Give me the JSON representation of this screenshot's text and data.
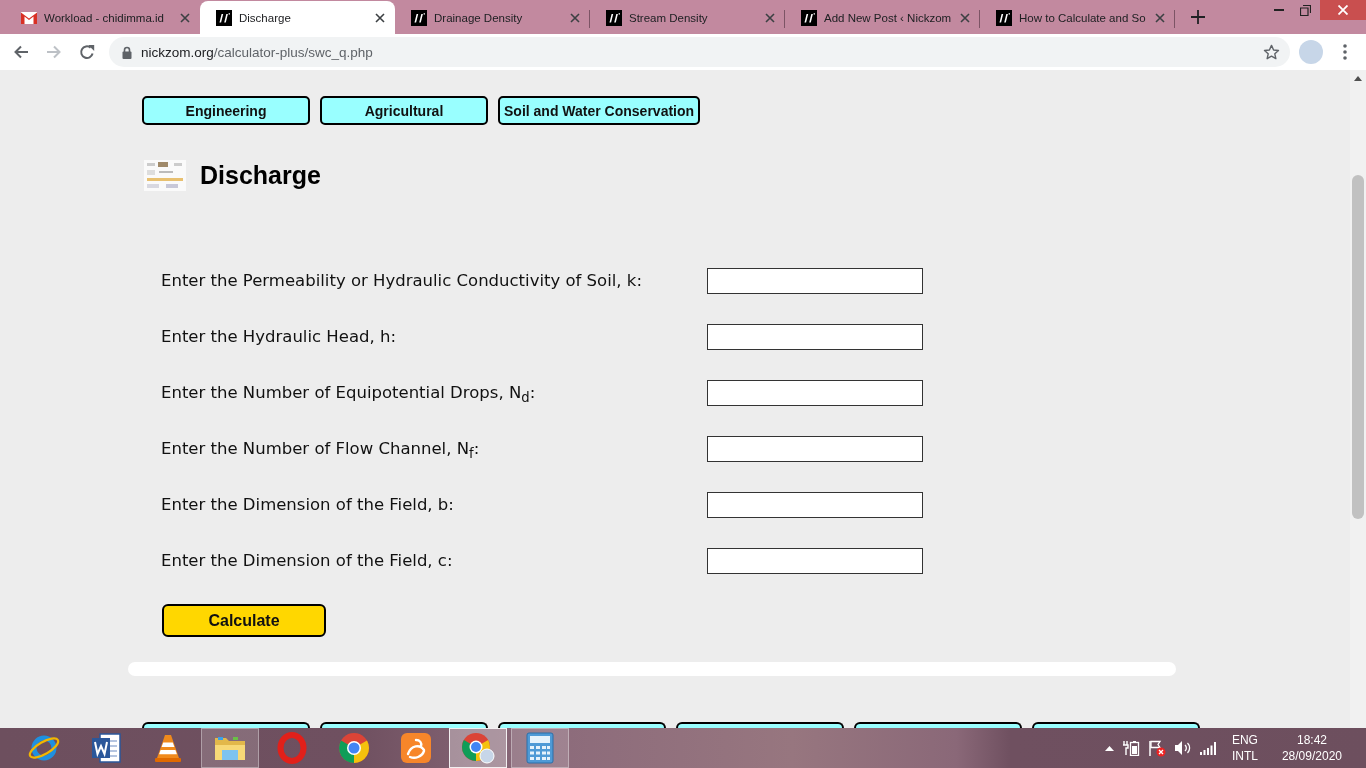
{
  "browser": {
    "tabs": [
      {
        "title": "Workload - chidimma.id",
        "kind": "mail",
        "selected": false
      },
      {
        "title": "Discharge",
        "kind": "site",
        "selected": true
      },
      {
        "title": "Drainage Density",
        "kind": "site",
        "selected": false
      },
      {
        "title": "Stream Density",
        "kind": "site",
        "selected": false
      },
      {
        "title": "Add New Post ‹ Nickzom",
        "kind": "site",
        "selected": false
      },
      {
        "title": "How to Calculate and So",
        "kind": "site",
        "selected": false
      }
    ],
    "navigation": [
      {
        "kind": "back",
        "disabled": false
      },
      {
        "kind": "forward",
        "disabled": true
      },
      {
        "kind": "reload",
        "disabled": false
      }
    ],
    "address_bar": {
      "domain": "nickzom.org",
      "path": "/calculator-plus/swc_q.php"
    }
  },
  "page": {
    "categories": [
      {
        "label": "Engineering"
      },
      {
        "label": "Agricultural"
      },
      {
        "label": "Soil and Water Conservation"
      }
    ],
    "title": "Discharge",
    "fields": [
      {
        "label": "Enter the Permeability or Hydraulic Conductivity of Soil, k:"
      },
      {
        "label": "Enter the Hydraulic Head, h:"
      },
      {
        "label": "Enter the Number of Equipotential Drops, N$_{d}$:"
      },
      {
        "label": "Enter the Number of Flow Channel, N$_{f}$:"
      },
      {
        "label": "Enter the Dimension of the Field, b:"
      },
      {
        "label": "Enter the Dimension of the Field, c:"
      }
    ],
    "calculate_button": "Calculate",
    "partly_hidden_buttons": [
      {
        "kind": "category"
      },
      {
        "kind": "category"
      },
      {
        "kind": "category"
      },
      {
        "kind": "category"
      },
      {
        "kind": "category"
      },
      {
        "kind": "category"
      }
    ]
  },
  "taskbar": {
    "apps": [
      {
        "kind": "globe",
        "running": false,
        "selected": false
      },
      {
        "kind": "document",
        "running": false,
        "selected": false
      },
      {
        "kind": "cone",
        "running": false,
        "selected": false
      },
      {
        "kind": "folder",
        "running": true,
        "selected": false
      },
      {
        "kind": "ring",
        "running": false,
        "selected": false
      },
      {
        "kind": "wheel",
        "running": false,
        "selected": false
      },
      {
        "kind": "tile",
        "running": false,
        "selected": false
      },
      {
        "kind": "profile",
        "running": true,
        "selected": true
      },
      {
        "kind": "calculator",
        "running": true,
        "selected": false
      }
    ],
    "language": "ENG",
    "layout": "INTL",
    "time": "18:42",
    "date": "28/09/2020"
  }
}
